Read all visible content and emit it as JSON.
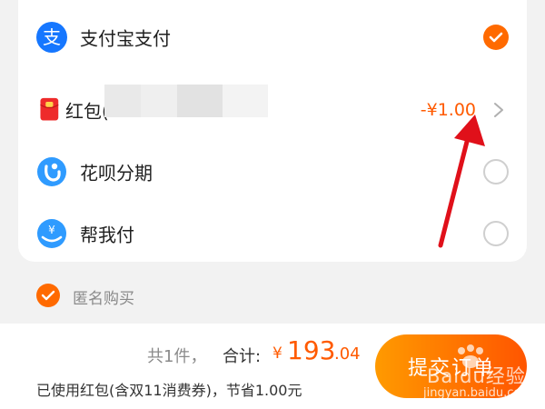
{
  "payment_methods": [
    {
      "label": "支付宝支付",
      "icon": "alipay-icon",
      "selected": true
    },
    {
      "label": "红包(",
      "icon": "red-envelope-icon",
      "amount": "-¥1.00"
    },
    {
      "label": "花呗分期",
      "icon": "huabei-icon",
      "selected": false
    },
    {
      "label": "帮我付",
      "icon": "pay-for-me-icon",
      "selected": false
    }
  ],
  "anonymous_purchase": {
    "label": "匿名购买",
    "checked": true
  },
  "footer": {
    "item_count": "共1件，",
    "total_label": "合计:",
    "currency": "¥",
    "total_int": "193",
    "total_dec": ".04",
    "discount_note": "已使用红包(含双11消费券)，节省1.00元",
    "submit_label": "提交订单"
  },
  "watermark": {
    "text": "Baidu经验",
    "url": "jingyan.baidu.com"
  },
  "colors": {
    "accent": "#ff6a00",
    "alipay_blue": "#1677ff",
    "price": "#ff5a00"
  }
}
